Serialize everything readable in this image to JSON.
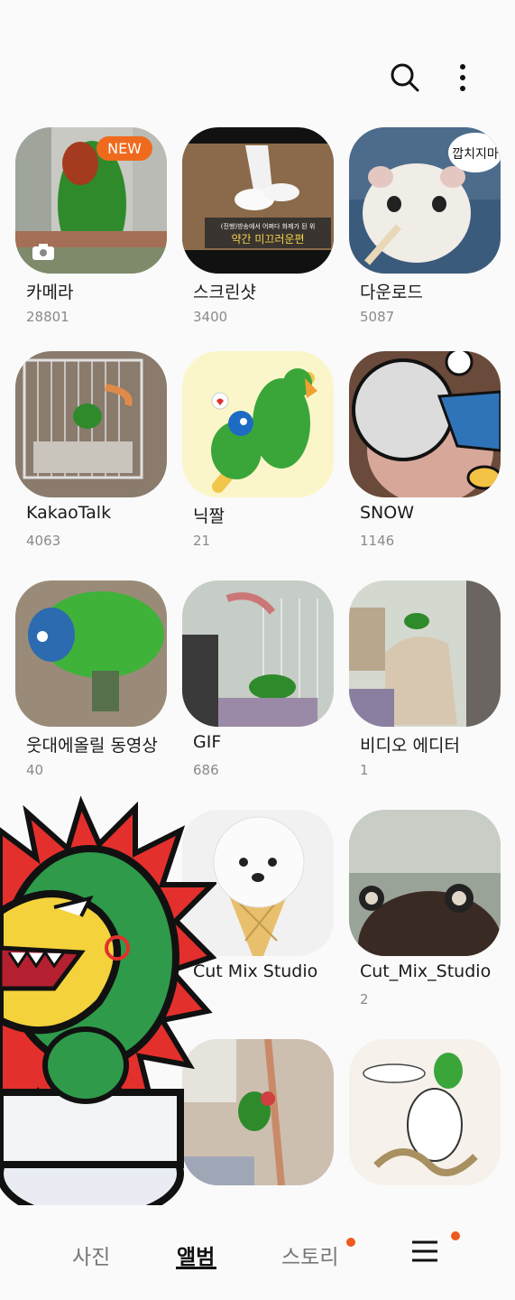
{
  "header": {
    "search_icon": "search-icon",
    "more_icon": "more-vertical-icon"
  },
  "albums": [
    {
      "name": "카메라",
      "count": "28801",
      "badge": "NEW"
    },
    {
      "name": "스크린샷",
      "count": "3400",
      "caption_line1": "(진행)방송에서 어쩌다 화제가 된 위",
      "caption_line2": "약간 미끄러운편"
    },
    {
      "name": "다운로드",
      "count": "5087",
      "bubble": "깝치지마"
    },
    {
      "name": "KakaoTalk",
      "count": "4063"
    },
    {
      "name": "닉짤",
      "count": "21"
    },
    {
      "name": "SNOW",
      "count": "1146"
    },
    {
      "name": "웃대에올릴 동영상",
      "count": "40"
    },
    {
      "name": "GIF",
      "count": "686"
    },
    {
      "name": "비디오 에디터",
      "count": "1"
    },
    {
      "name": "Cut Mix Studio",
      "count": ""
    },
    {
      "name": "Cut_Mix_Studio",
      "count": "2"
    }
  ],
  "bottom_nav": {
    "tabs": [
      "사진",
      "앨범",
      "스토리"
    ],
    "active": "앨범",
    "menu_icon": "hamburger-menu-icon",
    "accent": "#ef5a1d"
  }
}
